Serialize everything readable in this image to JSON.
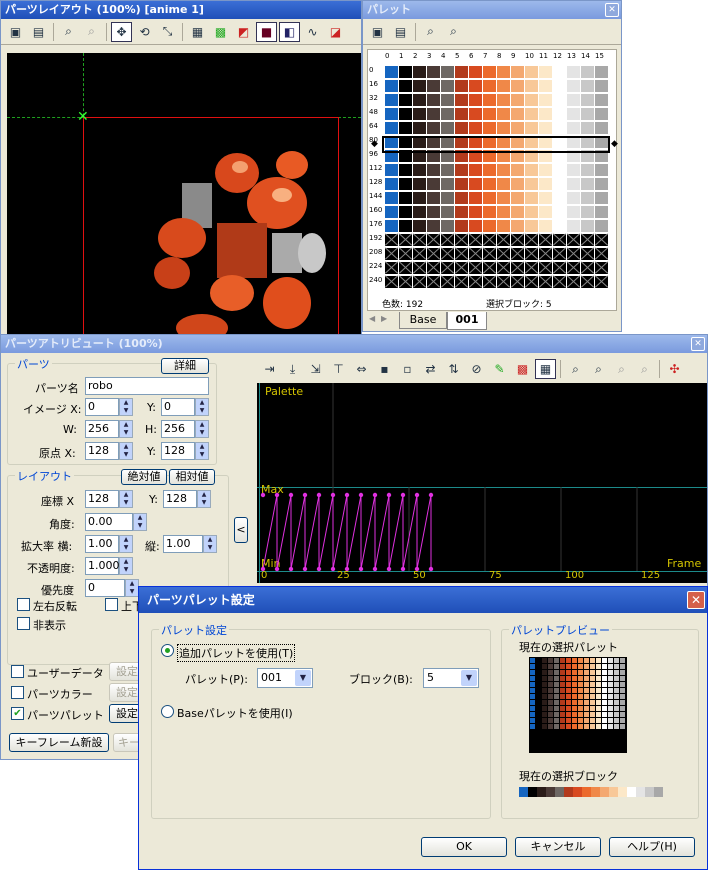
{
  "layout_window": {
    "title": "パーツレイアウト (100%) [anime 1]",
    "toolbar_icons": [
      "open-folder-icon",
      "save-icon",
      "zoom-in-icon",
      "zoom-out-icon",
      "move-icon",
      "rotate-icon",
      "scale-icon",
      "grid-icon",
      "palette-swap-icon",
      "color-icon",
      "frame-icon",
      "layer-icon",
      "curve-icon",
      "figure-icon"
    ]
  },
  "palette_window": {
    "title": "パレット",
    "columns": [
      "0",
      "1",
      "2",
      "3",
      "4",
      "5",
      "6",
      "7",
      "8",
      "9",
      "10",
      "11",
      "12",
      "13",
      "14",
      "15"
    ],
    "rows": [
      "0",
      "16",
      "32",
      "48",
      "64",
      "80",
      "96",
      "112",
      "128",
      "144",
      "160",
      "176",
      "192",
      "208",
      "224",
      "240"
    ],
    "status_colors": "色数: 192",
    "status_block": "選択ブロック: 5",
    "tabs": [
      "Base",
      "001"
    ],
    "tab_active": "001"
  },
  "attr_window": {
    "title": "パーツアトリビュート (100%)",
    "parts_group": "パーツ",
    "detail_button": "詳細",
    "part_name_label": "パーツ名",
    "part_name_value": "robo",
    "image_x_label": "イメージ X:",
    "image_x_value": "0",
    "image_y_label": "Y:",
    "image_y_value": "0",
    "w_label": "W:",
    "w_value": "256",
    "h_label": "H:",
    "h_value": "256",
    "origin_x_label": "原点 X:",
    "origin_x_value": "128",
    "origin_y_label": "Y:",
    "origin_y_value": "128",
    "layout_group": "レイアウト",
    "absolute_button": "絶対値",
    "relative_button": "相対値",
    "coord_x_label": "座標 X",
    "coord_x_value": "128",
    "coord_y_label": "Y:",
    "coord_y_value": "128",
    "angle_label": "角度:",
    "angle_value": "0.00",
    "scale_h_label": "拡大率 横:",
    "scale_h_value": "1.00",
    "scale_v_label": "縦:",
    "scale_v_value": "1.00",
    "opacity_label": "不透明度:",
    "opacity_value": "1.000",
    "priority_label": "優先度",
    "priority_value": "0",
    "flip_h_label": "左右反転",
    "flip_v_label": "上下",
    "hidden_label": "非表示",
    "user_data_label": "ユーザーデータ",
    "part_color_label": "パーツカラー",
    "part_palette_label": "パーツパレット",
    "settings_label": "設定",
    "keyframe_new_button": "キーフレーム新設",
    "keyframe_other_button": "キー",
    "collapse_arrow": "<",
    "graph_label_palette": "Palette",
    "graph_label_max": "Max",
    "graph_label_min": "Min",
    "graph_label_frame": "Frame",
    "graph_ticks": [
      "0",
      "25",
      "50",
      "75",
      "100",
      "125"
    ]
  },
  "dialog": {
    "title": "パーツパレット設定",
    "palette_settings_group": "パレット設定",
    "use_additional_radio": "追加パレットを使用(T)",
    "palette_label": "パレット(P):",
    "palette_value": "001",
    "block_label": "ブロック(B):",
    "block_value": "5",
    "use_base_radio": "Baseパレットを使用(I)",
    "preview_group": "パレットプレビュー",
    "current_palette_label": "現在の選択パレット",
    "current_block_label": "現在の選択ブロック",
    "ok_button": "OK",
    "cancel_button": "キャンセル",
    "help_button": "ヘルプ(H)"
  },
  "palette_block_colors": [
    "#1565c0",
    "#000000",
    "#2a1c18",
    "#4a3a36",
    "#6e6864",
    "#b23a1c",
    "#d84a20",
    "#ec6a2c",
    "#f08848",
    "#f4a870",
    "#f8c898",
    "#fce8c8",
    "#ffffff",
    "#e4e4e4",
    "#c8c8c8",
    "#a8a8a8"
  ]
}
